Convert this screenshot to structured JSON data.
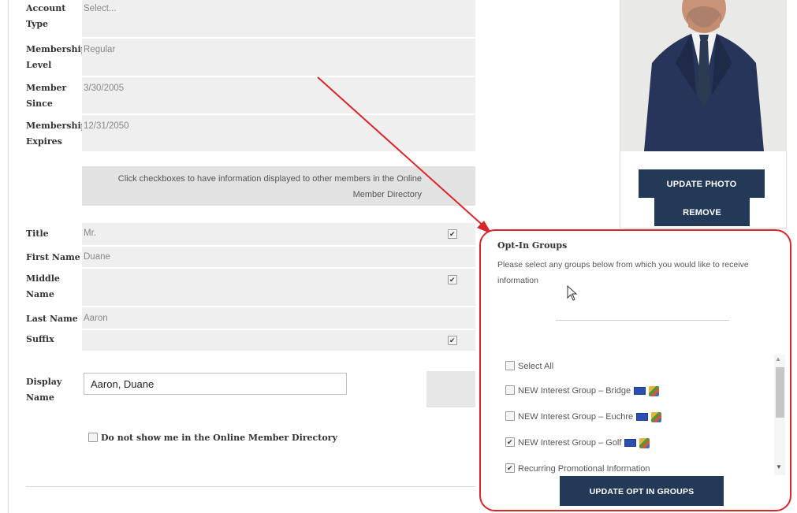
{
  "form": {
    "account_type": {
      "label_line1": "Account",
      "label_line2": "Type",
      "value": "Select..."
    },
    "membership_level": {
      "label_line1": "Membership",
      "label_line2": "Level",
      "value": "Regular"
    },
    "member_since": {
      "label_line1": "Member",
      "label_line2": "Since",
      "value": "3/30/2005"
    },
    "membership_expires": {
      "label_line1": "Membership",
      "label_line2": "Expires",
      "value": "12/31/2050"
    },
    "directory_note_line1": "Click checkboxes to have information displayed to other members in the Online",
    "directory_note_line2": "Member Directory",
    "title": {
      "label": "Title",
      "value": "Mr.",
      "checked": true
    },
    "first_name": {
      "label": "First Name",
      "value": "Duane",
      "checked": false
    },
    "middle_name": {
      "label_line1": "Middle",
      "label_line2": "Name",
      "value": "",
      "checked": true
    },
    "last_name": {
      "label": "Last Name",
      "value": "Aaron",
      "checked": false
    },
    "suffix": {
      "label": "Suffix",
      "value": "",
      "checked": true
    },
    "display_name": {
      "label_line1": "Display",
      "label_line2": "Name",
      "value": "Aaron, Duane"
    },
    "do_not_show_label": "Do not show me in the Online Member Directory",
    "do_not_show_checked": false
  },
  "photo": {
    "update_label": "UPDATE PHOTO",
    "remove_label": "REMOVE"
  },
  "opt_in": {
    "title": "Opt-In Groups",
    "description": "Please select any groups below from which you would like to receive information",
    "items": [
      {
        "label": "Select All",
        "checked": false,
        "icons": false
      },
      {
        "label": "NEW Interest Group – Bridge",
        "checked": false,
        "icons": true
      },
      {
        "label": "NEW Interest Group – Euchre",
        "checked": false,
        "icons": true
      },
      {
        "label": "NEW Interest Group – Golf",
        "checked": true,
        "icons": true
      },
      {
        "label": "Recurring Promotional Information",
        "checked": true,
        "icons": false
      }
    ],
    "update_label": "UPDATE OPT IN GROUPS"
  },
  "colors": {
    "accent_dark": "#223a57",
    "highlight_red": "#d8262b",
    "field_bg": "#efefef"
  }
}
